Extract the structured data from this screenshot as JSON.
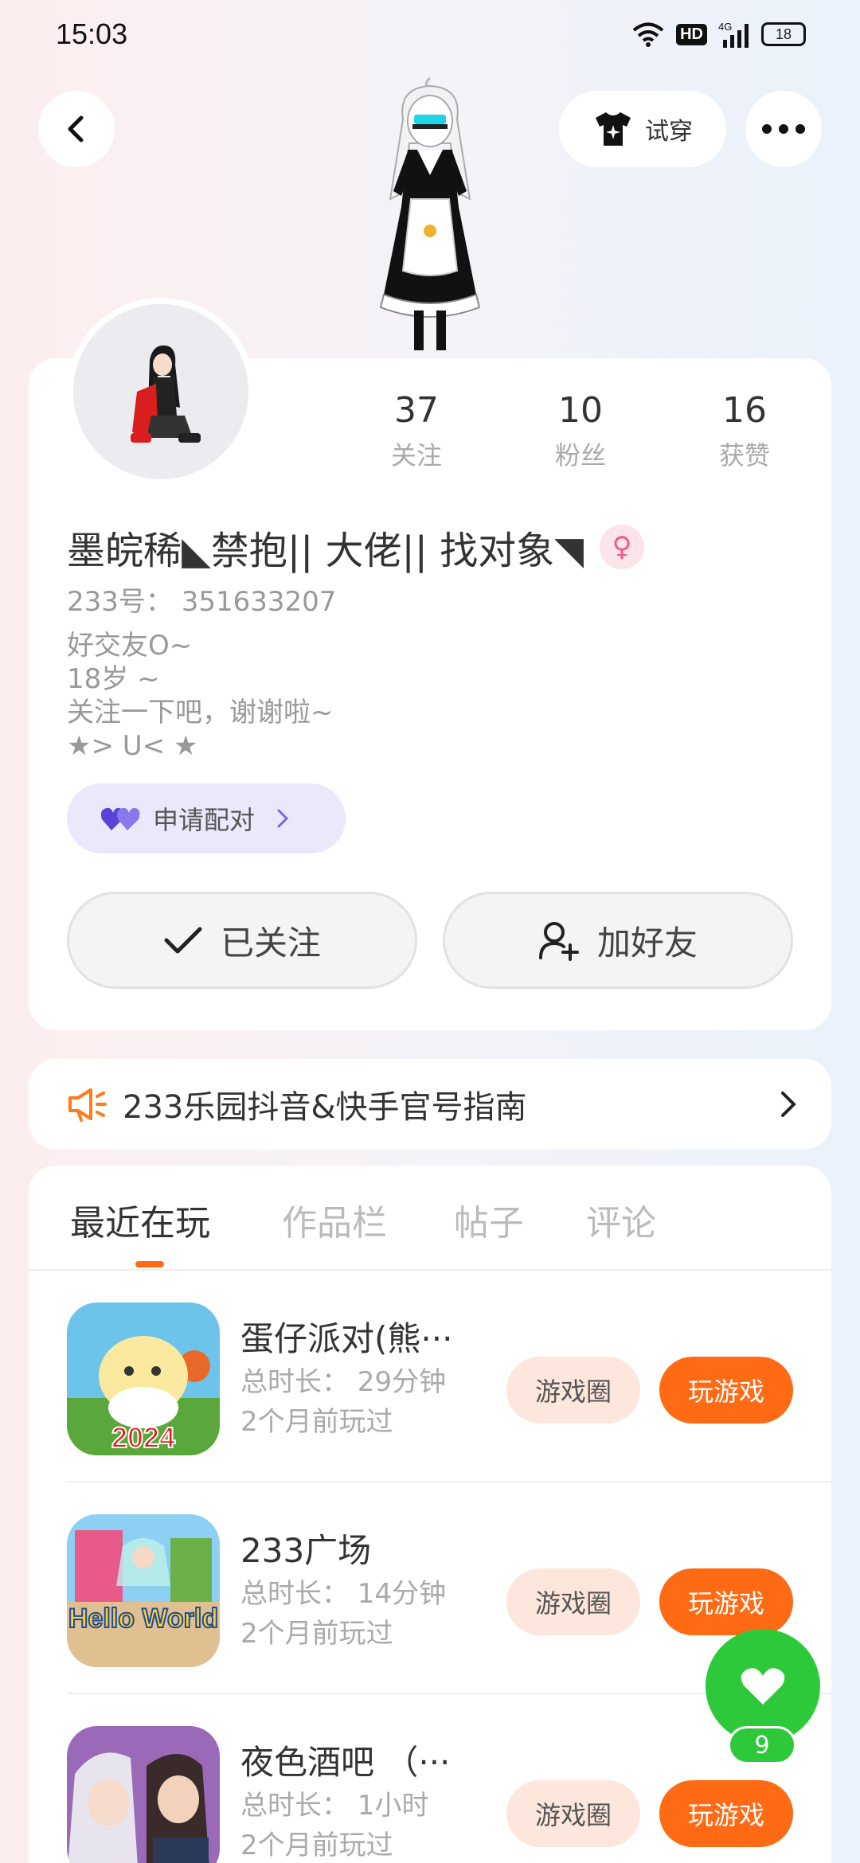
{
  "status_bar": {
    "time": "15:03",
    "hd": "HD",
    "network": "4G",
    "battery": "18"
  },
  "header": {
    "try_on_label": "试穿"
  },
  "profile": {
    "stats": [
      {
        "count": "37",
        "label": "关注"
      },
      {
        "count": "10",
        "label": "粉丝"
      },
      {
        "count": "16",
        "label": "获赞"
      }
    ],
    "nickname": "墨皖稀◣禁抱|| 大佬|| 找对象◥",
    "gender_symbol": "♀",
    "uid": "233号：  351633207",
    "bio": [
      "好交友O~",
      "18岁 ~",
      "关注一下吧，谢谢啦~",
      "★> U<  ★"
    ],
    "pair_label": "申请配对",
    "follow_label": "已关注",
    "add_friend_label": "加好友"
  },
  "notice": {
    "text": "233乐园抖音&快手官号指南"
  },
  "tabs": [
    "最近在玩",
    "作品栏",
    "帖子",
    "评论"
  ],
  "games": [
    {
      "name": "蛋仔派对(熊···",
      "duration": "总时长：  29分钟",
      "last_played": "2个月前玩过",
      "icon_text": "2024",
      "circle_label": "游戏圈",
      "play_label": "玩游戏"
    },
    {
      "name": "233广场",
      "duration": "总时长：  14分钟",
      "last_played": "2个月前玩过",
      "icon_text": "Hello World",
      "circle_label": "游戏圈",
      "play_label": "玩游戏"
    },
    {
      "name": "夜色酒吧 （···",
      "duration": "总时长：  1小时",
      "last_played": "2个月前玩过",
      "icon_text": "",
      "circle_label": "游戏圈",
      "play_label": "玩游戏"
    }
  ],
  "fab": {
    "count": "9"
  },
  "colors": {
    "accent": "#ff6a14",
    "pair": "#7a63e8",
    "fab": "#2ec93a"
  }
}
